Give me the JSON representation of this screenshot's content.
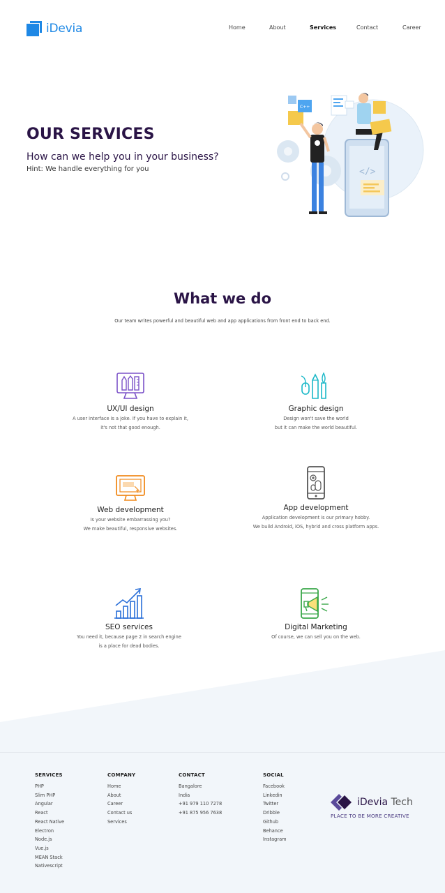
{
  "header": {
    "logo_text": "iDevia",
    "nav": [
      "Home",
      "About",
      "Services",
      "Contact",
      "Career"
    ],
    "active_nav": "Services"
  },
  "hero": {
    "title": "OUR SERVICES",
    "subtitle": "How can we help you in your business?",
    "hint": "Hint: We handle everything for you",
    "art_labels": [
      "C++",
      "</>"
    ]
  },
  "what_we_do": {
    "title": "What we do",
    "subtitle": "Our team writes powerful and beautiful web and app applications from front end to back end."
  },
  "services": [
    {
      "name": "UX/UI design",
      "icon": "design-tools-icon",
      "desc1": "A user interface is a joke. If you have to explain it,",
      "desc2": "it's not that good enough.",
      "color": "#7b52c8"
    },
    {
      "name": "Graphic design",
      "icon": "brushes-icon",
      "desc1": "Design won't save the world",
      "desc2": "but it can make the world beautiful.",
      "color": "#1ab8c8"
    },
    {
      "name": "Web development",
      "icon": "monitor-icon",
      "desc1": "Is your website embarrassing you?",
      "desc2": "We make beautiful, responsive websites.",
      "color": "#f08a1c"
    },
    {
      "name": "App development",
      "icon": "smartphone-icon",
      "desc1": "Application development is our primary hobby.",
      "desc2": "We build Android, iOS, hybrid and cross platform apps.",
      "color": "#555555"
    },
    {
      "name": "SEO services",
      "icon": "growth-chart-icon",
      "desc1": "You need it, because page 2 in search engine",
      "desc2": "is a place for dead bodies.",
      "color": "#2a6fd8"
    },
    {
      "name": "Digital Marketing",
      "icon": "megaphone-phone-icon",
      "desc1": "Of course, we can sell you on the web.",
      "desc2": "",
      "color": "#3aa84a"
    }
  ],
  "footer": {
    "services": {
      "heading": "SERVICES",
      "items": [
        "PHP",
        "Slim PHP",
        "Angular",
        "React",
        "React Native",
        "Electron",
        "Node.js",
        "Vue.js",
        "MEAN Stack",
        "Nativescript"
      ]
    },
    "company": {
      "heading": "COMPANY",
      "items": [
        "Home",
        "About",
        "Career",
        "Contact us",
        "Services"
      ]
    },
    "contact": {
      "heading": "CONTACT",
      "items": [
        "Bangalore",
        "India",
        "+91 979 110 7278",
        "+91 875 956 7638"
      ]
    },
    "social": {
      "heading": "SOCIAL",
      "items": [
        "Facebook",
        "Linkedin",
        "Twitter",
        "Dribble",
        "Github",
        "Behance",
        "Instagram"
      ]
    },
    "brand": {
      "name": "iDevia",
      "name_suffix": "Tech",
      "tagline": "PLACE TO BE MORE CREATIVE"
    }
  },
  "colors": {
    "brand_blue": "#1e88e5",
    "heading_purple": "#2a1446",
    "hero_bg": "#f2f6fa"
  }
}
